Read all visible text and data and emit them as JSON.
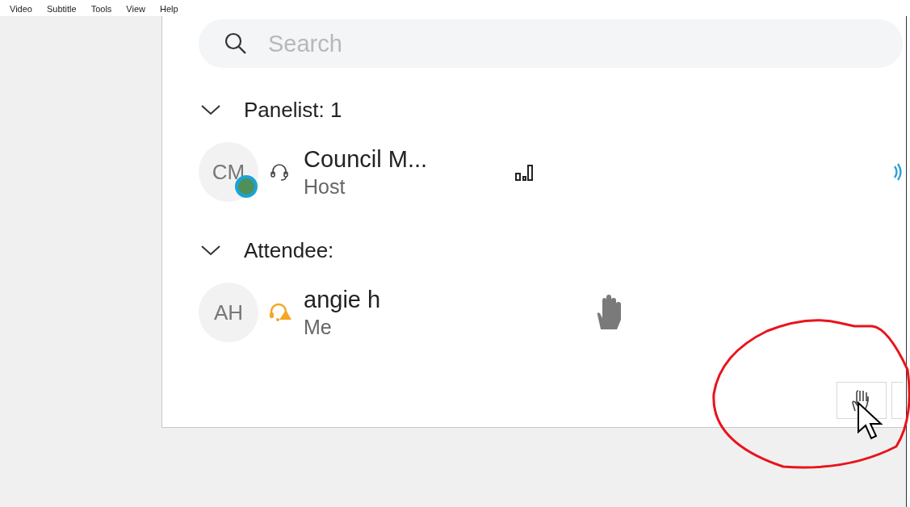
{
  "menu": [
    "Video",
    "Subtitle",
    "Tools",
    "View",
    "Help"
  ],
  "search": {
    "placeholder": "Search"
  },
  "groups": [
    {
      "label": "Panelist: 1",
      "expanded": true,
      "participants": [
        {
          "initials": "CM",
          "name": "Council M...",
          "role": "Host",
          "audio_active": false,
          "presenter_badge": true,
          "hand_raised": false,
          "speaking": true
        }
      ]
    },
    {
      "label": "Attendee:",
      "expanded": true,
      "participants": [
        {
          "initials": "AH",
          "name": "angie h",
          "role": "Me",
          "audio_active": true,
          "presenter_badge": false,
          "hand_raised": true,
          "speaking": false
        }
      ]
    }
  ]
}
